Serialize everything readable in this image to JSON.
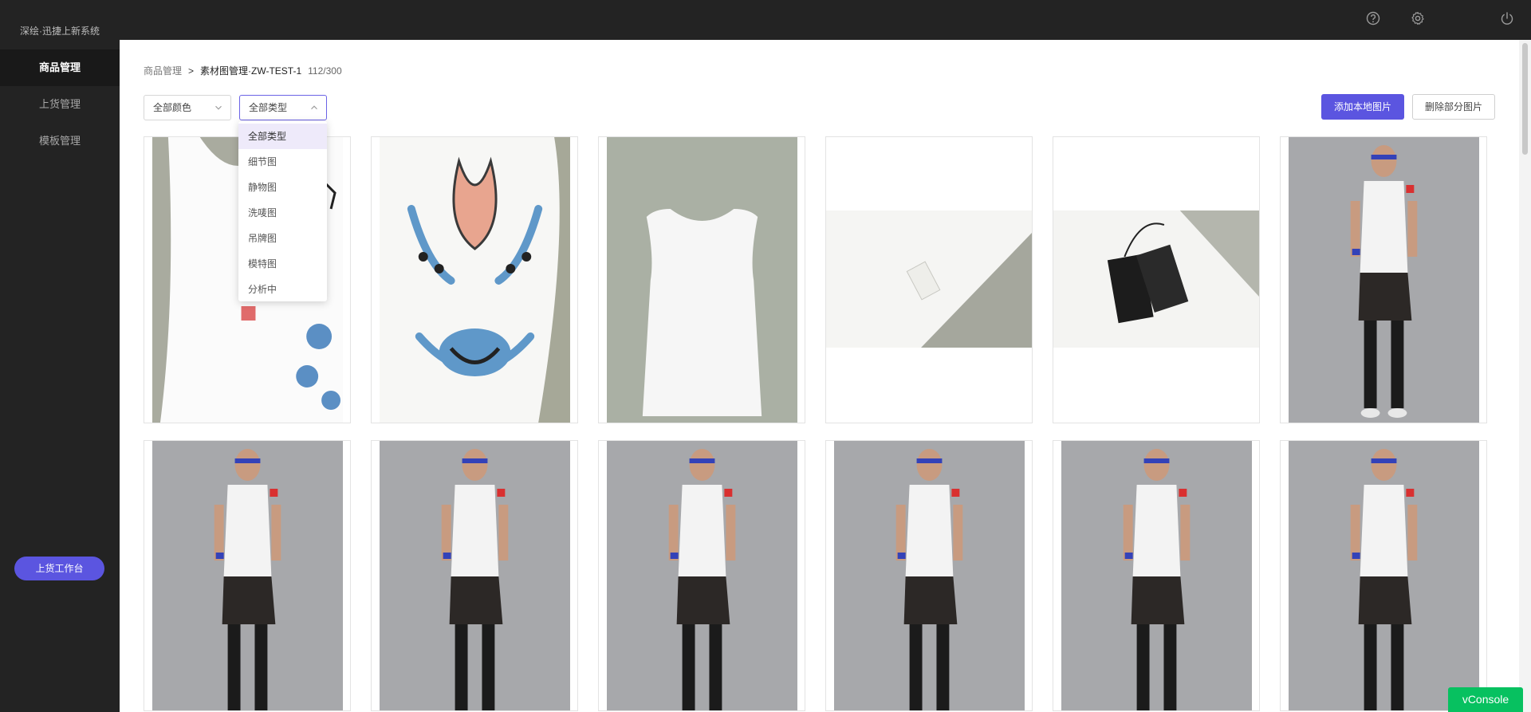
{
  "app": {
    "brand": "深绘·迅捷上新系统"
  },
  "sidebar": {
    "items": [
      {
        "label": "商品管理",
        "active": true
      },
      {
        "label": "上货管理",
        "active": false
      },
      {
        "label": "模板管理",
        "active": false
      }
    ],
    "workbench_label": "上货工作台"
  },
  "topbar": {
    "icons": [
      "help-icon",
      "gear-icon",
      "power-icon"
    ]
  },
  "breadcrumb": {
    "parent": "商品管理",
    "separator": ">",
    "current": "素材图管理·ZW-TEST-1",
    "count": "112/300"
  },
  "filters": {
    "color": {
      "value": "全部颜色"
    },
    "type": {
      "value": "全部类型",
      "options": [
        "全部类型",
        "细节图",
        "静物图",
        "洗唛图",
        "吊牌图",
        "模特图",
        "分析中"
      ],
      "selected_index": 0
    }
  },
  "actions": {
    "add_label": "添加本地图片",
    "delete_label": "删除部分图片"
  },
  "images": [
    {
      "kind": "detail-back",
      "desc": "shirt-detail"
    },
    {
      "kind": "detail-print",
      "desc": "opera-print"
    },
    {
      "kind": "flatlay",
      "desc": "tank-top"
    },
    {
      "kind": "wash-label",
      "desc": "care-label"
    },
    {
      "kind": "hang-tag",
      "desc": "hang-tag"
    },
    {
      "kind": "model",
      "desc": "model-photo"
    },
    {
      "kind": "model",
      "desc": "model-photo"
    },
    {
      "kind": "model",
      "desc": "model-photo"
    },
    {
      "kind": "model",
      "desc": "model-photo"
    },
    {
      "kind": "model",
      "desc": "model-photo"
    },
    {
      "kind": "model",
      "desc": "model-photo"
    },
    {
      "kind": "model",
      "desc": "model-photo"
    }
  ],
  "colors": {
    "accent": "#5b55e0",
    "sidebar_bg": "#232323",
    "vconsole": "#07c160"
  },
  "vconsole": {
    "label": "vConsole"
  }
}
